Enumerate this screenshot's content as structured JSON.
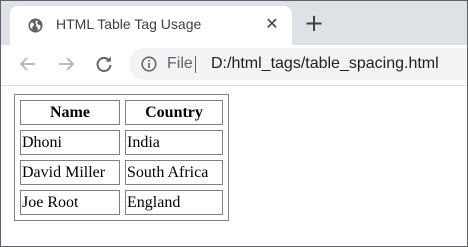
{
  "browser": {
    "tab": {
      "title": "HTML Table Tag Usage",
      "favicon": "globe-icon",
      "close": "close-icon"
    },
    "new_tab": "plus-icon",
    "toolbar": {
      "back": "back-arrow-icon",
      "forward": "forward-arrow-icon",
      "reload": "reload-icon",
      "info": "info-icon",
      "scheme_label": "File",
      "url": "D:/html_tags/table_spacing.html"
    }
  },
  "page": {
    "table": {
      "headers": [
        "Name",
        "Country"
      ],
      "rows": [
        [
          "Dhoni",
          "India"
        ],
        [
          "David Miller",
          "South Africa"
        ],
        [
          "Joe Root",
          "England"
        ]
      ]
    }
  },
  "colors": {
    "tabstrip": "#dee1e6",
    "omnibox": "#f1f3f4",
    "icon": "#5f6368",
    "table_border": "#808080"
  }
}
